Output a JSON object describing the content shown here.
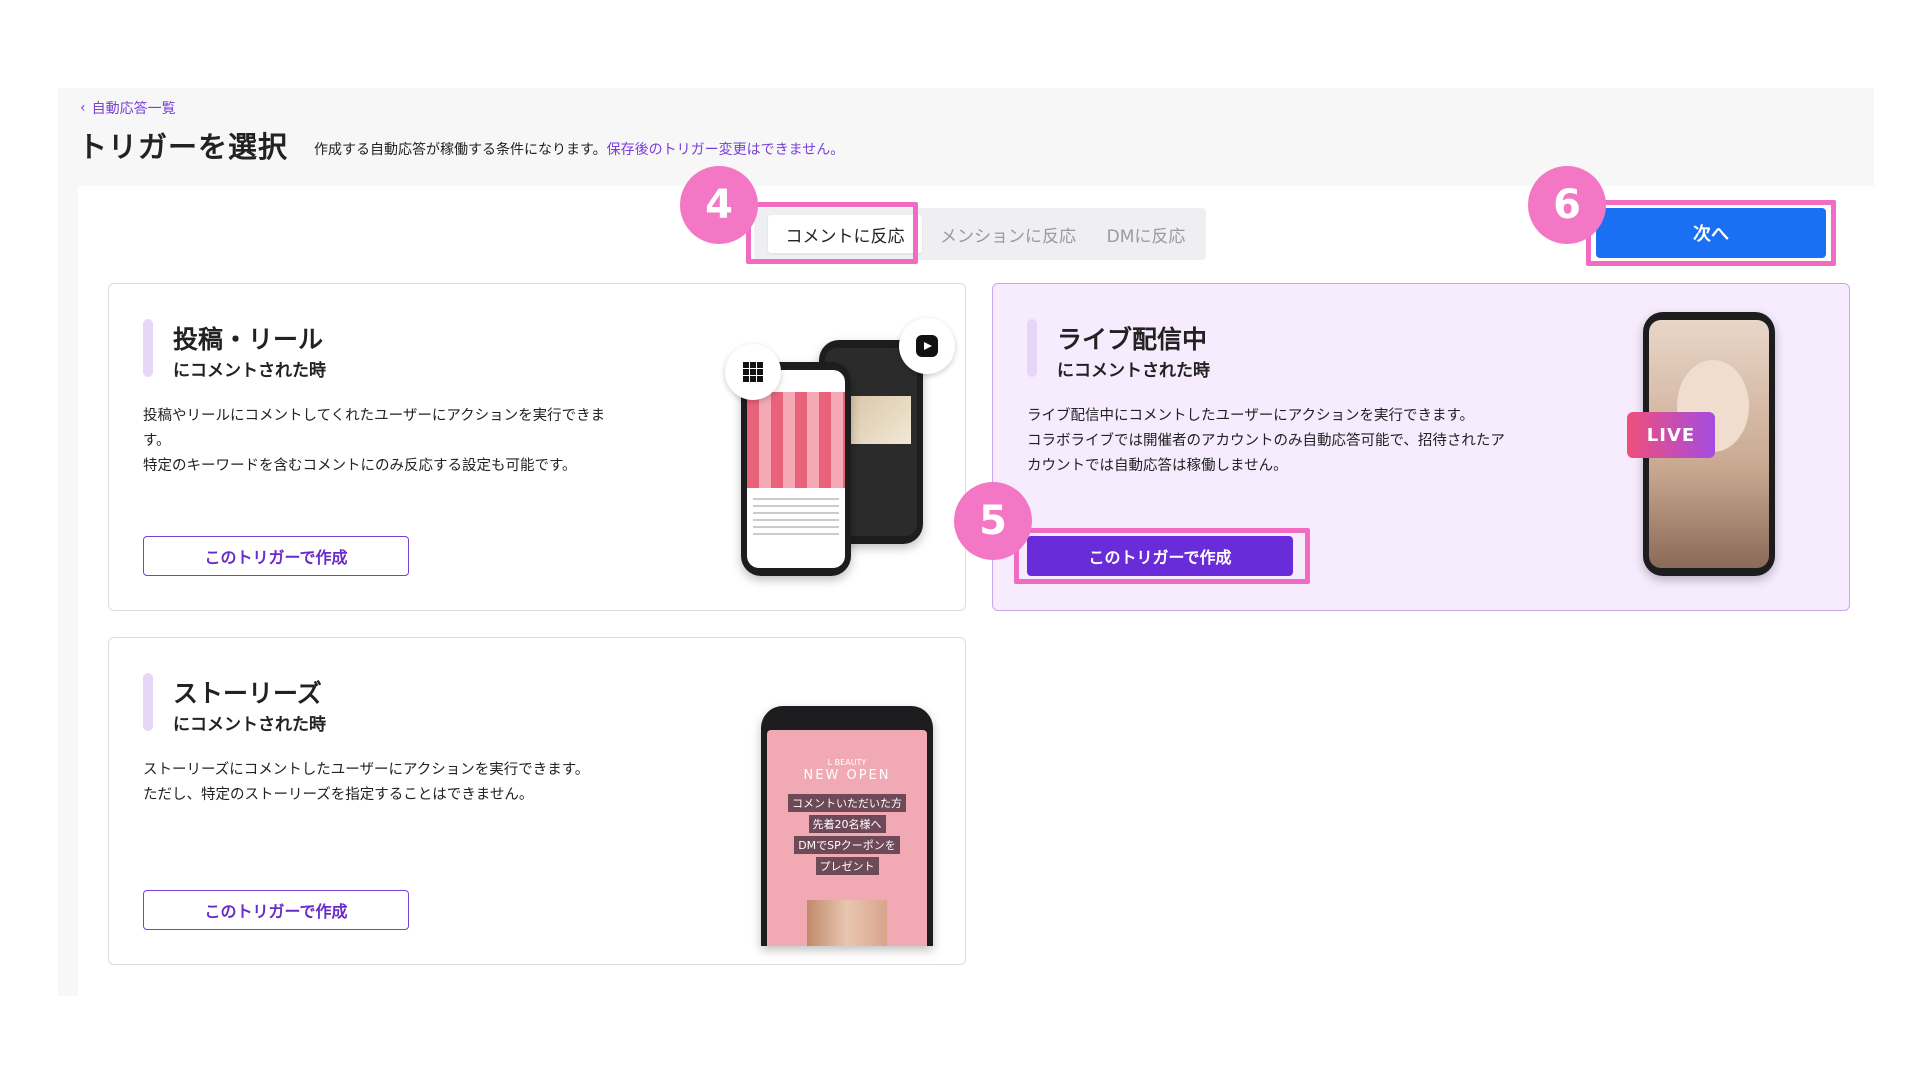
{
  "header": {
    "back_label": "自動応答一覧",
    "title": "トリガーを選択",
    "description": "作成する自動応答が稼働する条件になります。",
    "warning": "保存後のトリガー変更はできません。"
  },
  "tabs": [
    {
      "label": "コメントに反応",
      "active": true
    },
    {
      "label": "メンションに反応",
      "active": false
    },
    {
      "label": "DMに反応",
      "active": false
    }
  ],
  "next_button": "次へ",
  "annotations": {
    "tab_badge": "4",
    "create_badge": "5",
    "next_badge": "6"
  },
  "cards": [
    {
      "title": "投稿・リール",
      "subtitle": "にコメントされた時",
      "desc": [
        "投稿やリールにコメントしてくれたユーザーにアクションを実行できま",
        "す。",
        "特定のキーワードを含むコメントにのみ反応する設定も可能です。"
      ],
      "button": "このトリガーで作成",
      "selected": false
    },
    {
      "title": "ライブ配信中",
      "subtitle": "にコメントされた時",
      "desc": [
        "ライブ配信中にコメントしたユーザーにアクションを実行できます。",
        "コラボライブでは開催者のアカウントのみ自動応答可能で、招待されたア",
        "カウントでは自動応答は稼働しません。"
      ],
      "button": "このトリガーで作成",
      "selected": true,
      "live_badge": "LIVE"
    },
    {
      "title": "ストーリーズ",
      "subtitle": "にコメントされた時",
      "desc": [
        "ストーリーズにコメントしたユーザーにアクションを実行できます。",
        "ただし、特定のストーリーズを指定することはできません。"
      ],
      "button": "このトリガーで作成",
      "selected": false,
      "story": {
        "brand": "L BEAUTY",
        "headline": "NEW OPEN",
        "lines": [
          "コメントいただいた方",
          "先着20名様へ",
          "DMでSPクーポンを",
          "プレゼント"
        ]
      }
    }
  ],
  "colors": {
    "accent": "#7a3fd6",
    "primary": "#1a6ff2",
    "highlight": "#f06bc1",
    "selected_bg": "#f6ecfd"
  }
}
